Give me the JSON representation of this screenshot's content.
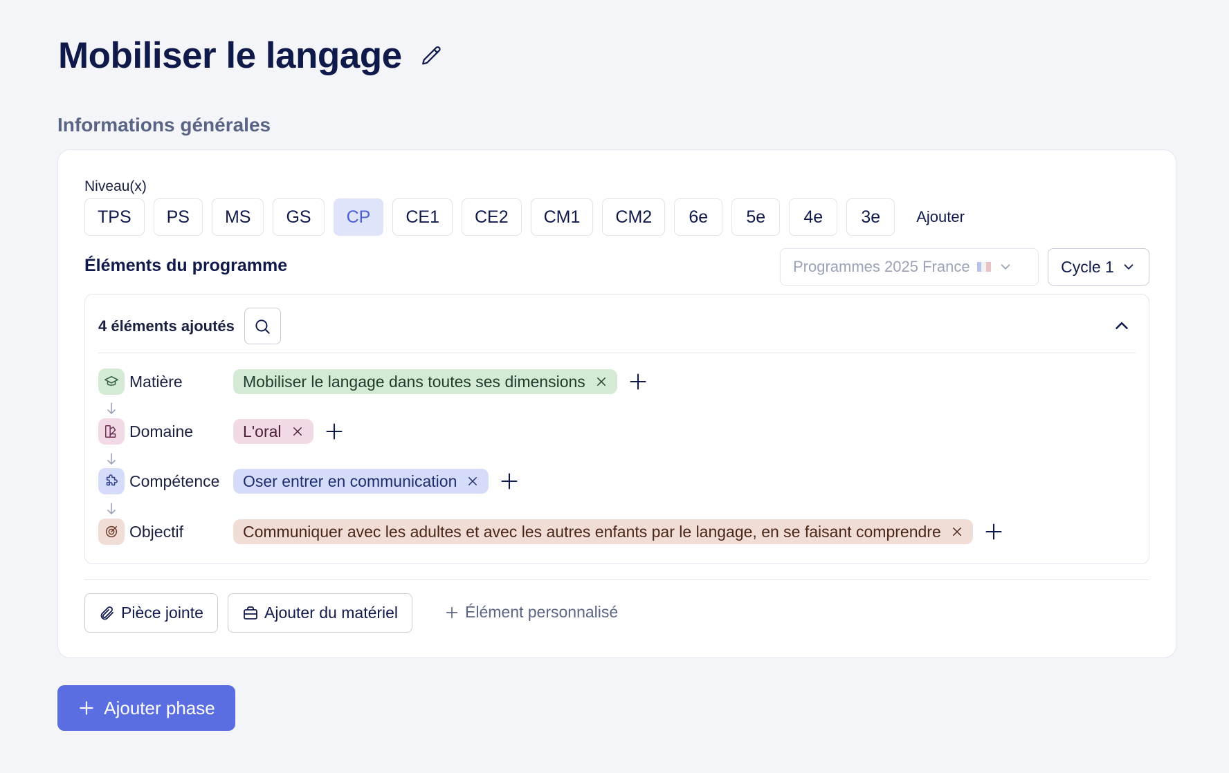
{
  "page": {
    "title": "Mobiliser le langage"
  },
  "general": {
    "heading": "Informations générales"
  },
  "levels": {
    "label": "Niveau(x)",
    "items": [
      "TPS",
      "PS",
      "MS",
      "GS",
      "CP",
      "CE1",
      "CE2",
      "CM1",
      "CM2",
      "6e",
      "5e",
      "4e",
      "3e"
    ],
    "selected": "CP",
    "add_label": "Ajouter"
  },
  "program": {
    "title": "Éléments du programme",
    "source_select": "Programmes 2025 France",
    "cycle_select": "Cycle 1"
  },
  "elements": {
    "count_label": "4 éléments ajoutés",
    "rows": [
      {
        "label": "Matière",
        "tag": "Mobiliser le langage dans toutes ses dimensions",
        "icon": "graduation-cap-icon"
      },
      {
        "label": "Domaine",
        "tag": "L'oral",
        "icon": "palette-icon"
      },
      {
        "label": "Compétence",
        "tag": "Oser entrer en communication",
        "icon": "puzzle-icon"
      },
      {
        "label": "Objectif",
        "tag": "Communiquer avec les adultes et avec les autres enfants par le langage, en se faisant comprendre",
        "icon": "target-icon"
      }
    ]
  },
  "actions": {
    "attachment": "Pièce jointe",
    "material": "Ajouter du matériel",
    "custom": "Élément personnalisé"
  },
  "footer": {
    "add_phase": "Ajouter phase"
  },
  "colors": {
    "accent": "#5b6ee1",
    "selected_chip_bg": "#dfe4fb",
    "matiere_bg": "#d4ead5",
    "domaine_bg": "#f1d9e6",
    "competence_bg": "#d4dcfa",
    "objectif_bg": "#f0ddd6"
  }
}
